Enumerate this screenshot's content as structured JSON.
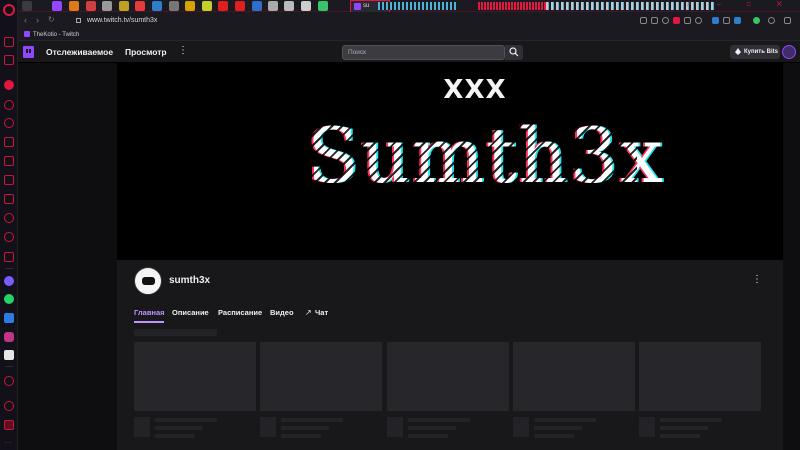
{
  "browser": {
    "url": "www.twitch.tv/sumth3x",
    "active_tab_label": "su",
    "bookmark_label": "TheKotio - Twitch"
  },
  "twitch_nav": {
    "following": "Отслеживаемое",
    "browse": "Просмотр",
    "more_icon": "⋮",
    "search_placeholder": "Поиск",
    "buy_bits": "Купить Bits"
  },
  "banner": {
    "top_text": "XXX",
    "name_text": "Sumth3x"
  },
  "channel": {
    "name": "sumth3x",
    "more_icon": "⋮",
    "tabs": [
      {
        "label": "Главная"
      },
      {
        "label": "Описание"
      },
      {
        "label": "Расписание"
      },
      {
        "label": "Видео"
      },
      {
        "label": "Чат"
      }
    ],
    "chat_icon": "↗"
  },
  "colors": {
    "accent_browser": "#e0173f",
    "twitch_purple": "#9146ff",
    "tab_active": "#bf94ff"
  }
}
